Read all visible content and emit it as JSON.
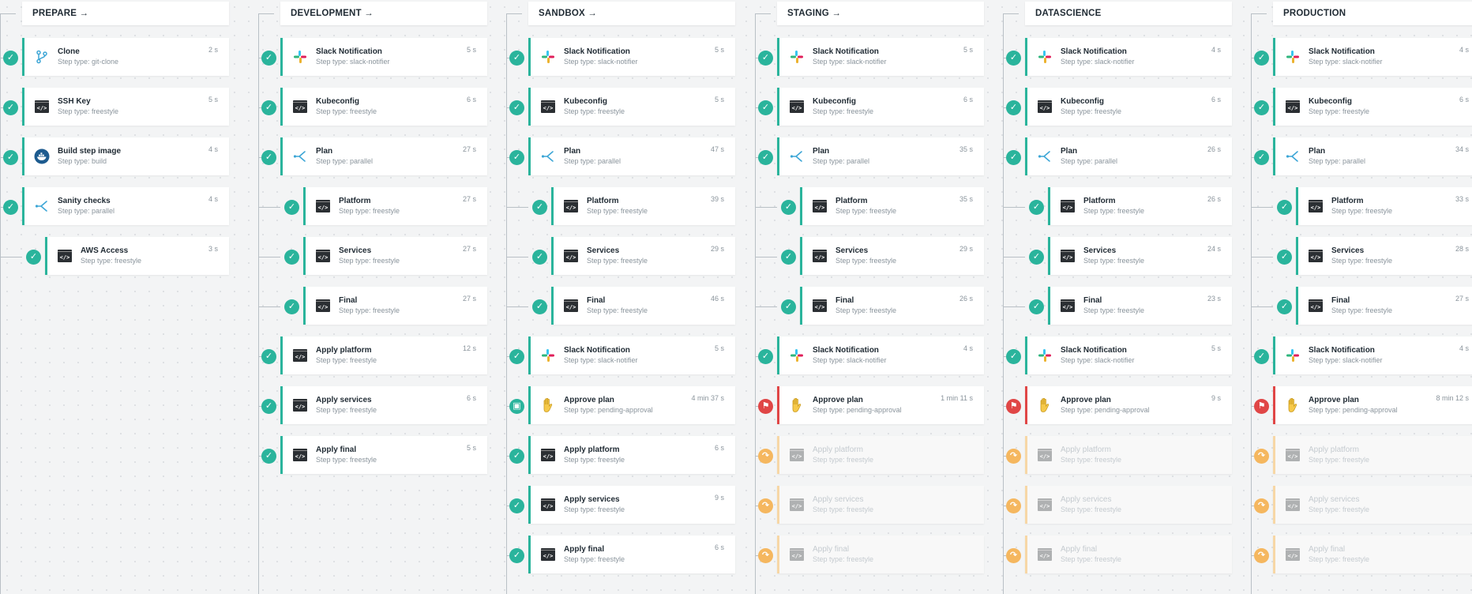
{
  "pipeline": {
    "columns": [
      {
        "title": "PREPARE →",
        "steps": [
          {
            "title": "Clone",
            "type": "Step type: git-clone",
            "duration": "2 s",
            "status": "success",
            "indent": 0,
            "icon": "git-branch-icon"
          },
          {
            "title": "SSH Key",
            "type": "Step type: freestyle",
            "duration": "5 s",
            "status": "success",
            "indent": 0,
            "icon": "terminal-icon"
          },
          {
            "title": "Build step image",
            "type": "Step type: build",
            "duration": "4 s",
            "status": "success",
            "indent": 0,
            "icon": "docker-icon"
          },
          {
            "title": "Sanity checks",
            "type": "Step type: parallel",
            "duration": "4 s",
            "status": "success",
            "indent": 0,
            "icon": "parallel-icon"
          },
          {
            "title": "AWS Access",
            "type": "Step type: freestyle",
            "duration": "3 s",
            "status": "success",
            "indent": 1,
            "icon": "terminal-icon"
          }
        ]
      },
      {
        "title": "DEVELOPMENT →",
        "steps": [
          {
            "title": "Slack Notification",
            "type": "Step type: slack-notifier",
            "duration": "5 s",
            "status": "success",
            "indent": 0,
            "icon": "slack-icon"
          },
          {
            "title": "Kubeconfig",
            "type": "Step type: freestyle",
            "duration": "6 s",
            "status": "success",
            "indent": 0,
            "icon": "terminal-icon"
          },
          {
            "title": "Plan",
            "type": "Step type: parallel",
            "duration": "27 s",
            "status": "success",
            "indent": 0,
            "icon": "parallel-icon"
          },
          {
            "title": "Platform",
            "type": "Step type: freestyle",
            "duration": "27 s",
            "status": "success",
            "indent": 1,
            "icon": "terminal-icon"
          },
          {
            "title": "Services",
            "type": "Step type: freestyle",
            "duration": "27 s",
            "status": "success",
            "indent": 1,
            "icon": "terminal-icon"
          },
          {
            "title": "Final",
            "type": "Step type: freestyle",
            "duration": "27 s",
            "status": "success",
            "indent": 1,
            "icon": "terminal-icon"
          },
          {
            "title": "Apply platform",
            "type": "Step type: freestyle",
            "duration": "12 s",
            "status": "success",
            "indent": 0,
            "icon": "terminal-icon"
          },
          {
            "title": "Apply services",
            "type": "Step type: freestyle",
            "duration": "6 s",
            "status": "success",
            "indent": 0,
            "icon": "terminal-icon"
          },
          {
            "title": "Apply final",
            "type": "Step type: freestyle",
            "duration": "5 s",
            "status": "success",
            "indent": 0,
            "icon": "terminal-icon"
          }
        ]
      },
      {
        "title": "SANDBOX →",
        "steps": [
          {
            "title": "Slack Notification",
            "type": "Step type: slack-notifier",
            "duration": "5 s",
            "status": "success",
            "indent": 0,
            "icon": "slack-icon"
          },
          {
            "title": "Kubeconfig",
            "type": "Step type: freestyle",
            "duration": "5 s",
            "status": "success",
            "indent": 0,
            "icon": "terminal-icon"
          },
          {
            "title": "Plan",
            "type": "Step type: parallel",
            "duration": "47 s",
            "status": "success",
            "indent": 0,
            "icon": "parallel-icon"
          },
          {
            "title": "Platform",
            "type": "Step type: freestyle",
            "duration": "39 s",
            "status": "success",
            "indent": 1,
            "icon": "terminal-icon"
          },
          {
            "title": "Services",
            "type": "Step type: freestyle",
            "duration": "29 s",
            "status": "success",
            "indent": 1,
            "icon": "terminal-icon"
          },
          {
            "title": "Final",
            "type": "Step type: freestyle",
            "duration": "46 s",
            "status": "success",
            "indent": 1,
            "icon": "terminal-icon"
          },
          {
            "title": "Slack Notification",
            "type": "Step type: slack-notifier",
            "duration": "5 s",
            "status": "success",
            "indent": 0,
            "icon": "slack-icon"
          },
          {
            "title": "Approve plan",
            "type": "Step type: pending-approval",
            "duration": "4 min 37 s",
            "status": "approved",
            "indent": 0,
            "icon": "hand-icon"
          },
          {
            "title": "Apply platform",
            "type": "Step type: freestyle",
            "duration": "6 s",
            "status": "success",
            "indent": 0,
            "icon": "terminal-icon"
          },
          {
            "title": "Apply services",
            "type": "Step type: freestyle",
            "duration": "9 s",
            "status": "success",
            "indent": 0,
            "icon": "terminal-icon"
          },
          {
            "title": "Apply final",
            "type": "Step type: freestyle",
            "duration": "6 s",
            "status": "success",
            "indent": 0,
            "icon": "terminal-icon"
          }
        ]
      },
      {
        "title": "STAGING →",
        "steps": [
          {
            "title": "Slack Notification",
            "type": "Step type: slack-notifier",
            "duration": "5 s",
            "status": "success",
            "indent": 0,
            "icon": "slack-icon"
          },
          {
            "title": "Kubeconfig",
            "type": "Step type: freestyle",
            "duration": "6 s",
            "status": "success",
            "indent": 0,
            "icon": "terminal-icon"
          },
          {
            "title": "Plan",
            "type": "Step type: parallel",
            "duration": "35 s",
            "status": "success",
            "indent": 0,
            "icon": "parallel-icon"
          },
          {
            "title": "Platform",
            "type": "Step type: freestyle",
            "duration": "35 s",
            "status": "success",
            "indent": 1,
            "icon": "terminal-icon"
          },
          {
            "title": "Services",
            "type": "Step type: freestyle",
            "duration": "29 s",
            "status": "success",
            "indent": 1,
            "icon": "terminal-icon"
          },
          {
            "title": "Final",
            "type": "Step type: freestyle",
            "duration": "26 s",
            "status": "success",
            "indent": 1,
            "icon": "terminal-icon"
          },
          {
            "title": "Slack Notification",
            "type": "Step type: slack-notifier",
            "duration": "4 s",
            "status": "success",
            "indent": 0,
            "icon": "slack-icon"
          },
          {
            "title": "Approve plan",
            "type": "Step type: pending-approval",
            "duration": "1 min 11 s",
            "status": "denied",
            "indent": 0,
            "icon": "hand-icon"
          },
          {
            "title": "Apply platform",
            "type": "Step type: freestyle",
            "duration": "",
            "status": "skipped",
            "indent": 0,
            "icon": "terminal-icon"
          },
          {
            "title": "Apply services",
            "type": "Step type: freestyle",
            "duration": "",
            "status": "skipped",
            "indent": 0,
            "icon": "terminal-icon"
          },
          {
            "title": "Apply final",
            "type": "Step type: freestyle",
            "duration": "",
            "status": "skipped",
            "indent": 0,
            "icon": "terminal-icon"
          }
        ]
      },
      {
        "title": "DATASCIENCE",
        "steps": [
          {
            "title": "Slack Notification",
            "type": "Step type: slack-notifier",
            "duration": "4 s",
            "status": "success",
            "indent": 0,
            "icon": "slack-icon"
          },
          {
            "title": "Kubeconfig",
            "type": "Step type: freestyle",
            "duration": "6 s",
            "status": "success",
            "indent": 0,
            "icon": "terminal-icon"
          },
          {
            "title": "Plan",
            "type": "Step type: parallel",
            "duration": "26 s",
            "status": "success",
            "indent": 0,
            "icon": "parallel-icon"
          },
          {
            "title": "Platform",
            "type": "Step type: freestyle",
            "duration": "26 s",
            "status": "success",
            "indent": 1,
            "icon": "terminal-icon"
          },
          {
            "title": "Services",
            "type": "Step type: freestyle",
            "duration": "24 s",
            "status": "success",
            "indent": 1,
            "icon": "terminal-icon"
          },
          {
            "title": "Final",
            "type": "Step type: freestyle",
            "duration": "23 s",
            "status": "success",
            "indent": 1,
            "icon": "terminal-icon"
          },
          {
            "title": "Slack Notification",
            "type": "Step type: slack-notifier",
            "duration": "5 s",
            "status": "success",
            "indent": 0,
            "icon": "slack-icon"
          },
          {
            "title": "Approve plan",
            "type": "Step type: pending-approval",
            "duration": "9 s",
            "status": "denied",
            "indent": 0,
            "icon": "hand-icon"
          },
          {
            "title": "Apply platform",
            "type": "Step type: freestyle",
            "duration": "",
            "status": "skipped",
            "indent": 0,
            "icon": "terminal-icon"
          },
          {
            "title": "Apply services",
            "type": "Step type: freestyle",
            "duration": "",
            "status": "skipped",
            "indent": 0,
            "icon": "terminal-icon"
          },
          {
            "title": "Apply final",
            "type": "Step type: freestyle",
            "duration": "",
            "status": "skipped",
            "indent": 0,
            "icon": "terminal-icon"
          }
        ]
      },
      {
        "title": "PRODUCTION",
        "steps": [
          {
            "title": "Slack Notification",
            "type": "Step type: slack-notifier",
            "duration": "4 s",
            "status": "success",
            "indent": 0,
            "icon": "slack-icon"
          },
          {
            "title": "Kubeconfig",
            "type": "Step type: freestyle",
            "duration": "6 s",
            "status": "success",
            "indent": 0,
            "icon": "terminal-icon"
          },
          {
            "title": "Plan",
            "type": "Step type: parallel",
            "duration": "34 s",
            "status": "success",
            "indent": 0,
            "icon": "parallel-icon"
          },
          {
            "title": "Platform",
            "type": "Step type: freestyle",
            "duration": "33 s",
            "status": "success",
            "indent": 1,
            "icon": "terminal-icon"
          },
          {
            "title": "Services",
            "type": "Step type: freestyle",
            "duration": "28 s",
            "status": "success",
            "indent": 1,
            "icon": "terminal-icon"
          },
          {
            "title": "Final",
            "type": "Step type: freestyle",
            "duration": "27 s",
            "status": "success",
            "indent": 1,
            "icon": "terminal-icon"
          },
          {
            "title": "Slack Notification",
            "type": "Step type: slack-notifier",
            "duration": "4 s",
            "status": "success",
            "indent": 0,
            "icon": "slack-icon"
          },
          {
            "title": "Approve plan",
            "type": "Step type: pending-approval",
            "duration": "8 min 12 s",
            "status": "denied",
            "indent": 0,
            "icon": "hand-icon"
          },
          {
            "title": "Apply platform",
            "type": "Step type: freestyle",
            "duration": "",
            "status": "skipped",
            "indent": 0,
            "icon": "terminal-icon"
          },
          {
            "title": "Apply services",
            "type": "Step type: freestyle",
            "duration": "",
            "status": "skipped",
            "indent": 0,
            "icon": "terminal-icon"
          },
          {
            "title": "Apply final",
            "type": "Step type: freestyle",
            "duration": "",
            "status": "skipped",
            "indent": 0,
            "icon": "terminal-icon"
          }
        ]
      }
    ]
  },
  "colors": {
    "success": "#2ab49c",
    "denied": "#e04646",
    "skipped": "#f5b75f",
    "background": "#f3f4f5"
  }
}
